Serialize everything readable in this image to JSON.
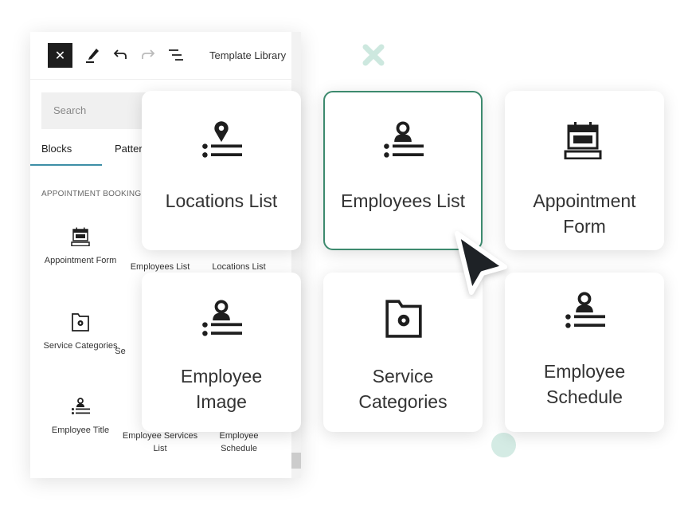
{
  "header": {
    "close_icon": "close-icon",
    "title": "Template Library",
    "tools": [
      "pencil-icon",
      "undo-icon",
      "redo-icon",
      "list-view-icon"
    ]
  },
  "search": {
    "placeholder": "Search"
  },
  "tabs": [
    {
      "label": "Blocks",
      "active": true
    },
    {
      "label": "Patter"
    }
  ],
  "section": "APPOINTMENT BOOKING",
  "blocks": [
    {
      "label": "Appointment Form",
      "icon": "calendar-form-icon"
    },
    {
      "label": "Employees List",
      "icon": "employee-list-icon"
    },
    {
      "label": "Locations List",
      "icon": "location-list-icon"
    },
    {
      "label": "Service Categories",
      "icon": "folder-gear-icon"
    },
    {
      "label": "Se",
      "icon": ""
    },
    {
      "label": "",
      "icon": ""
    },
    {
      "label": "Employee Title",
      "icon": "employee-list-icon"
    },
    {
      "label": "Employee Services List",
      "icon": ""
    },
    {
      "label": "Employee Schedule",
      "icon": ""
    }
  ],
  "cards": [
    {
      "label": "Locations List",
      "icon": "location-list-icon"
    },
    {
      "label": "Employees List",
      "icon": "employee-list-icon",
      "selected": true
    },
    {
      "label": "Appointment Form",
      "icon": "calendar-form-icon"
    },
    {
      "label": "Employee Image",
      "icon": "employee-list-icon"
    },
    {
      "label": "Service Categories",
      "icon": "folder-gear-icon"
    },
    {
      "label": "Employee Schedule",
      "icon": "employee-list-icon"
    }
  ],
  "colors": {
    "accent": "#3d8a6e",
    "tab_underline": "#3d8ea6",
    "decor": "#cde8df"
  }
}
